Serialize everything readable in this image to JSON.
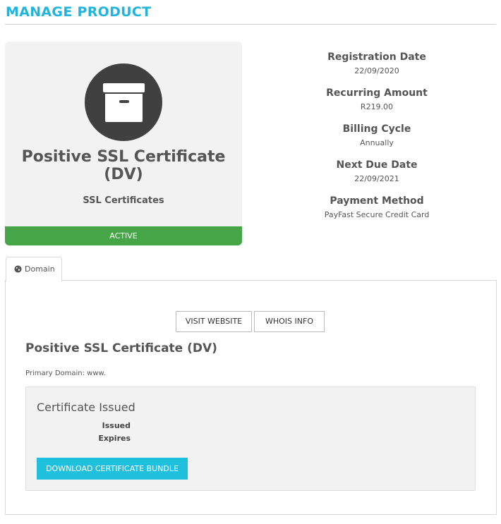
{
  "page": {
    "title": "MANAGE PRODUCT"
  },
  "product": {
    "name": "Positive SSL Certificate (DV)",
    "group": "SSL Certificates",
    "status": "ACTIVE",
    "icon": "archive-box-icon"
  },
  "info": [
    {
      "label": "Registration Date",
      "value": "22/09/2020"
    },
    {
      "label": "Recurring Amount",
      "value": "R219.00"
    },
    {
      "label": "Billing Cycle",
      "value": "Annually"
    },
    {
      "label": "Next Due Date",
      "value": "22/09/2021"
    },
    {
      "label": "Payment Method",
      "value": "PayFast Secure Credit Card"
    }
  ],
  "tabs": [
    {
      "label": "Domain",
      "icon": "globe-icon"
    }
  ],
  "domain_panel": {
    "visit_label": "VISIT WEBSITE",
    "whois_label": "WHOIS INFO",
    "title": "Positive SSL Certificate (DV)",
    "primary_domain": "Primary Domain: www."
  },
  "certificate": {
    "heading": "Certificate Issued",
    "issued_label": "Issued",
    "expires_label": "Expires",
    "download_label": "DOWNLOAD CERTIFICATE BUNDLE"
  },
  "colors": {
    "accent": "#22b4dc",
    "status_active": "#46a546",
    "download_button": "#1fc0de",
    "icon_circle": "#404040"
  }
}
